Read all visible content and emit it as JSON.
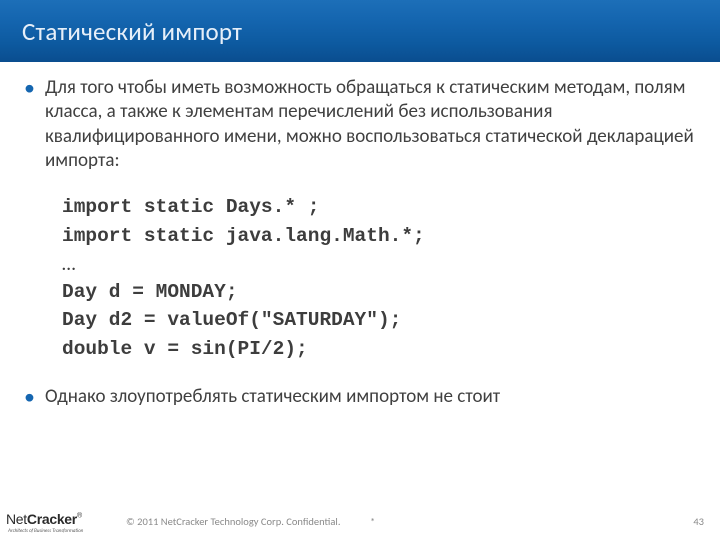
{
  "header": {
    "title": "Статический импорт"
  },
  "bullets": [
    "Для того чтобы иметь возможность обращаться к статическим методам, полям класса, а также к элементам перечислений без использования квалифицированного имени, можно воспользоваться статической декларацией импорта:",
    "Однако злоупотреблять статическим импортом не стоит"
  ],
  "code": {
    "l1": "import static Days.* ;",
    "l2": "import static java.lang.Math.*;",
    "l3": "…",
    "l4": "Day d = MONDAY;",
    "l5": "Day d2 = valueOf(\"SATURDAY\");",
    "l6": "double v = sin(PI/2);"
  },
  "footer": {
    "logo_net": "Net",
    "logo_cracker": "Cracker",
    "logo_r": "®",
    "logo_tagline": "Architects of Business Transformation",
    "copyright": "© 2011 NetCracker Technology Corp. Confidential.",
    "asterisk": "*",
    "page": "43"
  }
}
